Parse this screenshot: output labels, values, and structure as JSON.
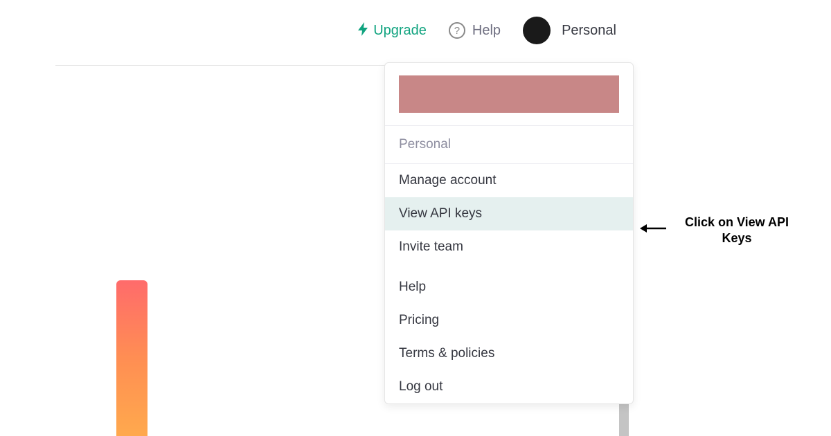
{
  "header": {
    "upgrade_label": "Upgrade",
    "help_label": "Help",
    "account_label": "Personal"
  },
  "dropdown": {
    "section_label": "Personal",
    "items": {
      "manage_account": "Manage account",
      "view_api_keys": "View API keys",
      "invite_team": "Invite team",
      "help": "Help",
      "pricing": "Pricing",
      "terms": "Terms & policies",
      "logout": "Log out"
    }
  },
  "annotation": {
    "text": "Click on View API Keys"
  }
}
